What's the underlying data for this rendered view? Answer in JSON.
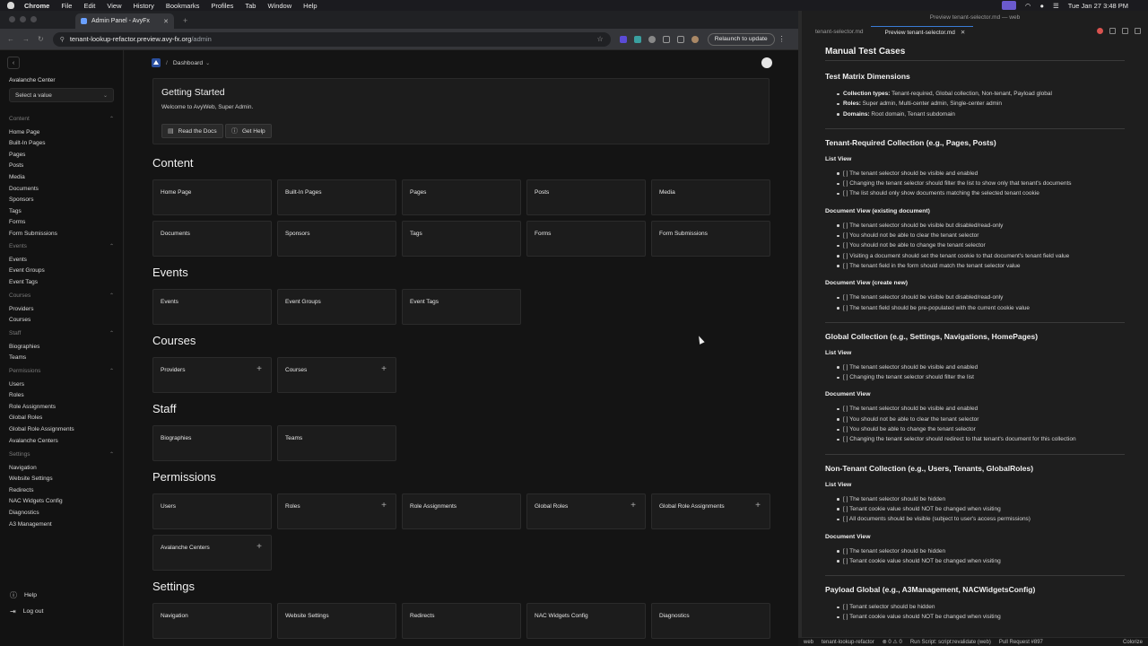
{
  "menubar": {
    "app": "Chrome",
    "items": [
      "File",
      "Edit",
      "View",
      "History",
      "Bookmarks",
      "Profiles",
      "Tab",
      "Window",
      "Help"
    ],
    "clock": "Tue Jan 27  3:48 PM"
  },
  "browser": {
    "tab_title": "Admin Panel - AvyFx",
    "url_host": "tenant-lookup-refactor.preview.avy-fx.org",
    "url_path": "/admin",
    "relaunch_label": "Relaunch to update"
  },
  "sidebar": {
    "center_label": "Avalanche Center",
    "select_placeholder": "Select a value",
    "groups": [
      {
        "title": "Content",
        "items": [
          "Home Page",
          "Built-In Pages",
          "Pages",
          "Posts",
          "Media",
          "Documents",
          "Sponsors",
          "Tags",
          "Forms",
          "Form Submissions"
        ]
      },
      {
        "title": "Events",
        "items": [
          "Events",
          "Event Groups",
          "Event Tags"
        ]
      },
      {
        "title": "Courses",
        "items": [
          "Providers",
          "Courses"
        ]
      },
      {
        "title": "Staff",
        "items": [
          "Biographies",
          "Teams"
        ]
      },
      {
        "title": "Permissions",
        "items": [
          "Users",
          "Roles",
          "Role Assignments",
          "Global Roles",
          "Global Role Assignments",
          "Avalanche Centers"
        ]
      },
      {
        "title": "Settings",
        "items": [
          "Navigation",
          "Website Settings",
          "Redirects",
          "NAC Widgets Config",
          "Diagnostics",
          "A3 Management"
        ]
      }
    ],
    "help": "Help",
    "logout": "Log out"
  },
  "main": {
    "breadcrumb": "Dashboard",
    "getting_started": {
      "title": "Getting Started",
      "welcome": "Welcome to AvyWeb, Super Admin.",
      "read_docs": "Read the Docs",
      "get_help": "Get Help"
    },
    "sections": [
      {
        "title": "Content",
        "cards": [
          {
            "label": "Home Page",
            "plus": false
          },
          {
            "label": "Built-In Pages",
            "plus": false
          },
          {
            "label": "Pages",
            "plus": false
          },
          {
            "label": "Posts",
            "plus": false
          },
          {
            "label": "Media",
            "plus": false
          },
          {
            "label": "Documents",
            "plus": false
          },
          {
            "label": "Sponsors",
            "plus": false
          },
          {
            "label": "Tags",
            "plus": false
          },
          {
            "label": "Forms",
            "plus": false
          },
          {
            "label": "Form Submissions",
            "plus": false
          }
        ]
      },
      {
        "title": "Events",
        "cards": [
          {
            "label": "Events",
            "plus": false
          },
          {
            "label": "Event Groups",
            "plus": false
          },
          {
            "label": "Event Tags",
            "plus": false
          }
        ]
      },
      {
        "title": "Courses",
        "cards": [
          {
            "label": "Providers",
            "plus": true
          },
          {
            "label": "Courses",
            "plus": true
          }
        ]
      },
      {
        "title": "Staff",
        "cards": [
          {
            "label": "Biographies",
            "plus": false
          },
          {
            "label": "Teams",
            "plus": false
          }
        ]
      },
      {
        "title": "Permissions",
        "cards": [
          {
            "label": "Users",
            "plus": false
          },
          {
            "label": "Roles",
            "plus": true
          },
          {
            "label": "Role Assignments",
            "plus": false
          },
          {
            "label": "Global Roles",
            "plus": true
          },
          {
            "label": "Global Role Assignments",
            "plus": true
          },
          {
            "label": "Avalanche Centers",
            "plus": true
          }
        ]
      },
      {
        "title": "Settings",
        "cards": [
          {
            "label": "Navigation",
            "plus": false
          },
          {
            "label": "Website Settings",
            "plus": false
          },
          {
            "label": "Redirects",
            "plus": false
          },
          {
            "label": "NAC Widgets Config",
            "plus": false
          },
          {
            "label": "Diagnostics",
            "plus": false
          }
        ]
      }
    ]
  },
  "editor": {
    "window_title": "Preview tenant-selector.md — web",
    "tabs": [
      "tenant-selector.md",
      "Preview tenant-selector.md"
    ],
    "doc": [
      {
        "t": "h2",
        "text": "Manual Test Cases"
      },
      {
        "t": "h3",
        "text": "Test Matrix Dimensions"
      },
      {
        "t": "ul",
        "items": [
          {
            "b": "Collection types:",
            "text": " Tenant-required, Global collection, Non-tenant, Payload global"
          },
          {
            "b": "Roles:",
            "text": " Super admin, Multi-center admin, Single-center admin"
          },
          {
            "b": "Domains:",
            "text": " Root domain, Tenant subdomain"
          }
        ]
      },
      {
        "t": "h3r",
        "text": "Tenant-Required Collection (e.g., Pages, Posts)"
      },
      {
        "t": "h4",
        "text": "List View"
      },
      {
        "t": "ul",
        "items": [
          {
            "text": "[ ] The tenant selector should be visible and enabled"
          },
          {
            "text": "[ ] Changing the tenant selector should filter the list to show only that tenant's documents"
          },
          {
            "text": "[ ] The list should only show documents matching the selected tenant cookie"
          }
        ]
      },
      {
        "t": "h4",
        "text": "Document View (existing document)"
      },
      {
        "t": "ul",
        "items": [
          {
            "text": "[ ] The tenant selector should be visible but disabled/read-only"
          },
          {
            "text": "[ ] You should not be able to clear the tenant selector"
          },
          {
            "text": "[ ] You should not be able to change the tenant selector"
          },
          {
            "text": "[ ] Visiting a document should set the tenant cookie to that document's tenant field value"
          },
          {
            "text": "[ ] The tenant field in the form should match the tenant selector value"
          }
        ]
      },
      {
        "t": "h4",
        "text": "Document View (create new)"
      },
      {
        "t": "ul",
        "items": [
          {
            "text": "[ ] The tenant selector should be visible but disabled/read-only"
          },
          {
            "text": "[ ] The tenant field should be pre-populated with the current cookie value"
          }
        ]
      },
      {
        "t": "h3r",
        "text": "Global Collection (e.g., Settings, Navigations, HomePages)"
      },
      {
        "t": "h4",
        "text": "List View"
      },
      {
        "t": "ul",
        "items": [
          {
            "text": "[ ] The tenant selector should be visible and enabled"
          },
          {
            "text": "[ ] Changing the tenant selector should filter the list"
          }
        ]
      },
      {
        "t": "h4",
        "text": "Document View"
      },
      {
        "t": "ul",
        "items": [
          {
            "text": "[ ] The tenant selector should be visible and enabled"
          },
          {
            "text": "[ ] You should not be able to clear the tenant selector"
          },
          {
            "text": "[ ] You should be able to change the tenant selector"
          },
          {
            "text": "[ ] Changing the tenant selector should redirect to that tenant's document for this collection"
          }
        ]
      },
      {
        "t": "h3r",
        "text": "Non-Tenant Collection (e.g., Users, Tenants, GlobalRoles)"
      },
      {
        "t": "h4",
        "text": "List View"
      },
      {
        "t": "ul",
        "items": [
          {
            "text": "[ ] The tenant selector should be hidden"
          },
          {
            "text": "[ ] Tenant cookie value should NOT be changed when visiting"
          },
          {
            "text": "[ ] All documents should be visible (subject to user's access permissions)"
          }
        ]
      },
      {
        "t": "h4",
        "text": "Document View"
      },
      {
        "t": "ul",
        "items": [
          {
            "text": "[ ] The tenant selector should be hidden"
          },
          {
            "text": "[ ] Tenant cookie value should NOT be changed when visiting"
          }
        ]
      },
      {
        "t": "h3r",
        "text": "Payload Global (e.g., A3Management, NACWidgetsConfig)"
      },
      {
        "t": "ul",
        "items": [
          {
            "text": "[ ] Tenant selector should be hidden"
          },
          {
            "text": "[ ] Tenant cookie value should NOT be changed when visiting"
          }
        ]
      }
    ],
    "status": {
      "left": [
        "web",
        "tenant-lookup-refactor",
        "⊗ 0 ⚠ 0",
        "Run Script: script:revalidate (web)",
        "Pull Request #897"
      ],
      "right": "Colorize"
    }
  }
}
